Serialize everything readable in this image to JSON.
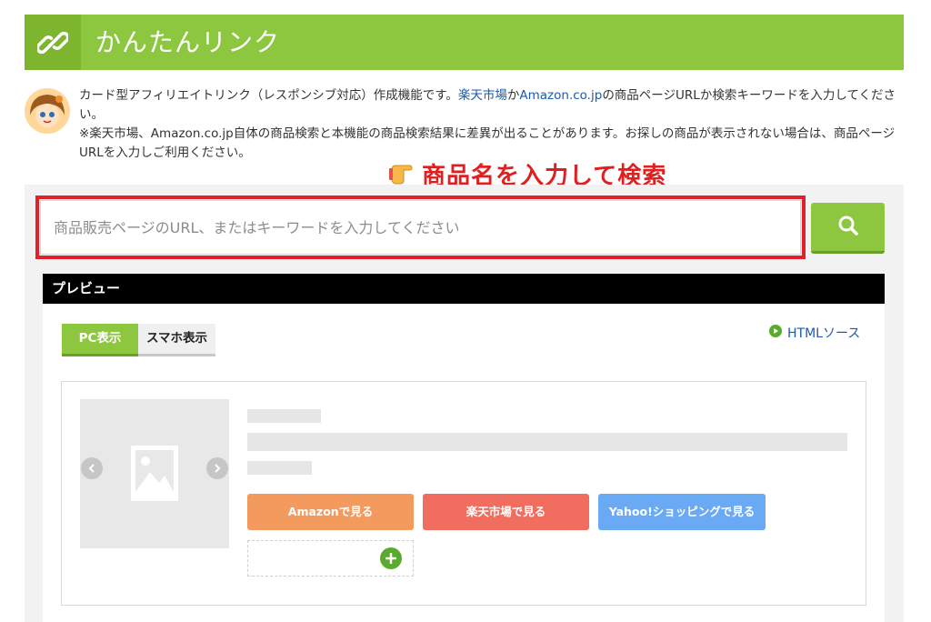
{
  "header": {
    "title": "かんたんリンク"
  },
  "intro": {
    "line1_a": "カード型アフィリエイトリンク（レスポンシブ対応）作成機能です。",
    "link_rakuten": "楽天市場",
    "line1_b": "か",
    "link_amazon": "Amazon.co.jp",
    "line1_c": "の商品ページURLか検索キーワードを入力してください。",
    "line2": "※楽天市場、Amazon.co.jp自体の商品検索と本機能の商品検索結果に差異が出ることがあります。お探しの商品が表示されない場合は、商品ページURLを入力しご利用ください。"
  },
  "hint": {
    "text": "商品名を入力して検索",
    "icon": "pointing-hand-icon"
  },
  "search": {
    "placeholder": "商品販売ページのURL、またはキーワードを入力してください",
    "value": "",
    "button_icon": "search-icon"
  },
  "preview": {
    "title": "プレビュー",
    "tabs": [
      {
        "label": "PC表示",
        "active": true
      },
      {
        "label": "スマホ表示",
        "active": false
      }
    ],
    "html_source_label": "HTMLソース",
    "shop_buttons": [
      {
        "label": "Amazonで見る",
        "color": "#f39a5f"
      },
      {
        "label": "楽天市場で見る",
        "color": "#f16d5f"
      },
      {
        "label": "Yahoo!ショッピングで見る",
        "color": "#6aaaf5"
      }
    ]
  },
  "colors": {
    "accent": "#8dc63f",
    "highlight": "#e0202a",
    "link": "#1a5ab0"
  }
}
